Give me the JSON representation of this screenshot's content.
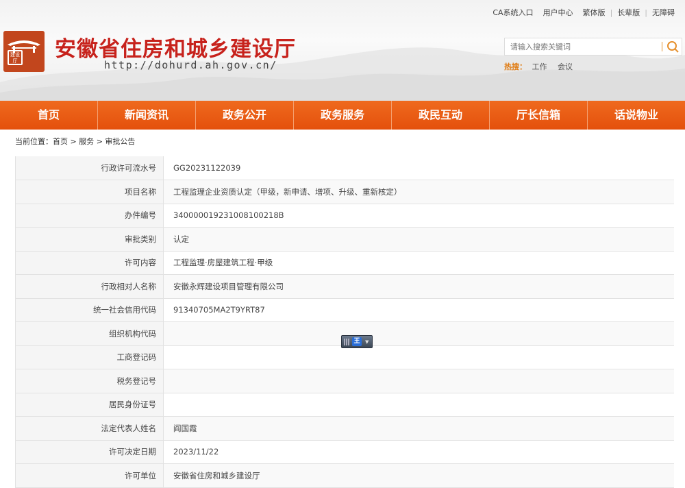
{
  "toplinks": [
    "CA系统入口",
    "用户中心",
    "繁体版",
    "长辈版",
    "无障碍"
  ],
  "site": {
    "logo_text": "建设厅",
    "title": "安徽省住房和城乡建设厅",
    "url": "http://dohurd.ah.gov.cn/"
  },
  "search": {
    "placeholder": "请输入搜索关键词"
  },
  "hot": {
    "label": "热搜：",
    "items": [
      "工作",
      "会议"
    ]
  },
  "nav": [
    "首页",
    "新闻资讯",
    "政务公开",
    "政务服务",
    "政民互动",
    "厅长信箱",
    "话说物业"
  ],
  "breadcrumb": "当前位置：首页 > 服务 > 审批公告",
  "ime": {
    "label": "王"
  },
  "rows": [
    {
      "key": "行政许可流水号",
      "value": "GG20231122039"
    },
    {
      "key": "项目名称",
      "value": "工程监理企业资质认定（甲级，新申请、增项、升级、重新核定）"
    },
    {
      "key": "办件编号",
      "value": "340000019231008100218B"
    },
    {
      "key": "审批类别",
      "value": "认定"
    },
    {
      "key": "许可内容",
      "value": "工程监理·房屋建筑工程·甲级"
    },
    {
      "key": "行政相对人名称",
      "value": "安徽永辉建设项目管理有限公司"
    },
    {
      "key": "统一社会信用代码",
      "value": "91340705MA2T9YRT87"
    },
    {
      "key": "组织机构代码",
      "value": ""
    },
    {
      "key": "工商登记码",
      "value": ""
    },
    {
      "key": "税务登记号",
      "value": ""
    },
    {
      "key": "居民身份证号",
      "value": ""
    },
    {
      "key": "法定代表人姓名",
      "value": "阎国霞"
    },
    {
      "key": "许可决定日期",
      "value": "2023/11/22"
    },
    {
      "key": "许可单位",
      "value": "安徽省住房和城乡建设厅"
    }
  ]
}
